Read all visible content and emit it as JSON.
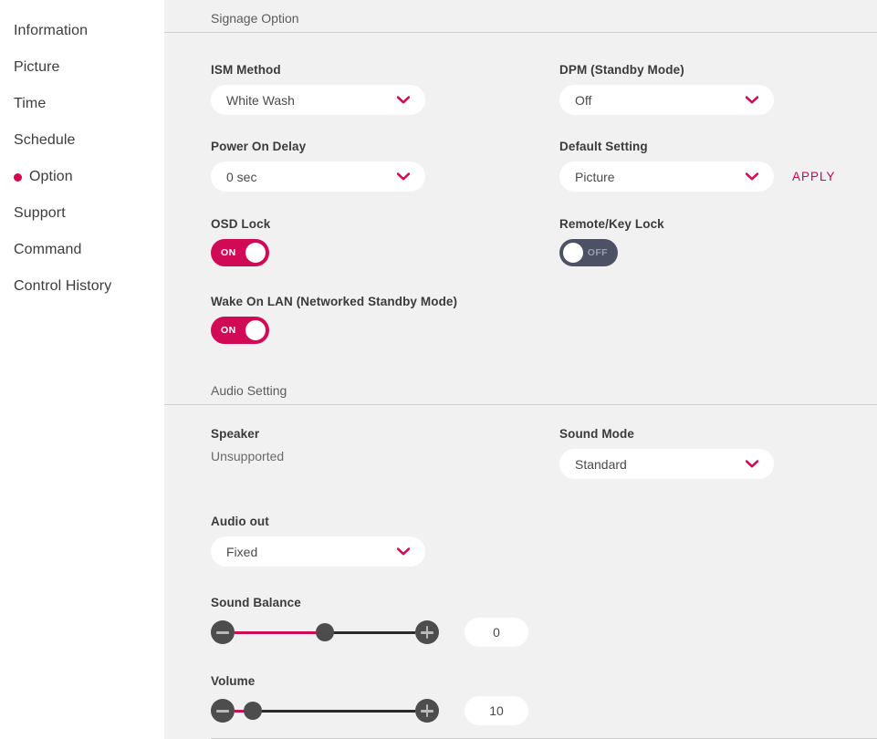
{
  "sidebar": {
    "items": [
      {
        "label": "Information",
        "active": false
      },
      {
        "label": "Picture",
        "active": false
      },
      {
        "label": "Time",
        "active": false
      },
      {
        "label": "Schedule",
        "active": false
      },
      {
        "label": "Option",
        "active": true
      },
      {
        "label": "Support",
        "active": false
      },
      {
        "label": "Command",
        "active": false
      },
      {
        "label": "Control History",
        "active": false
      }
    ]
  },
  "theme": {
    "accent": "#d10a56",
    "accent_text": "#c8005a",
    "toggle_off_bg": "#4c5263",
    "content_bg": "#f1f1f1",
    "slider_btn": "#4d4d4d"
  },
  "sections": {
    "signage": {
      "title": "Signage Option",
      "ism_method": {
        "label": "ISM Method",
        "value": "White Wash"
      },
      "dpm": {
        "label": "DPM (Standby Mode)",
        "value": "Off"
      },
      "power_on_delay": {
        "label": "Power On Delay",
        "value": "0 sec"
      },
      "default_setting": {
        "label": "Default Setting",
        "value": "Picture",
        "apply": "APPLY"
      },
      "osd_lock": {
        "label": "OSD Lock",
        "state": "ON"
      },
      "remote_key_lock": {
        "label": "Remote/Key Lock",
        "state": "OFF"
      },
      "wake_on_lan": {
        "label": "Wake On LAN (Networked Standby Mode)",
        "state": "ON"
      }
    },
    "audio": {
      "title": "Audio Setting",
      "speaker": {
        "label": "Speaker",
        "value": "Unsupported"
      },
      "sound_mode": {
        "label": "Sound Mode",
        "value": "Standard"
      },
      "audio_out": {
        "label": "Audio out",
        "value": "Fixed"
      },
      "sound_balance": {
        "label": "Sound Balance",
        "value": "0",
        "percent": 50
      },
      "volume": {
        "label": "Volume",
        "value": "10",
        "percent": 10
      }
    }
  },
  "icons": {
    "chevron": "chevron-down-icon",
    "minus": "minus-icon",
    "plus": "plus-icon"
  }
}
